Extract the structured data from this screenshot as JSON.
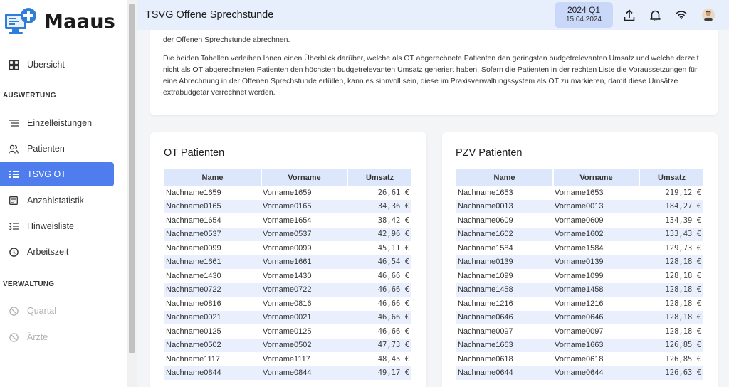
{
  "app": {
    "logo_text": "Maaus",
    "title": "TSVG Offene Sprechstunde"
  },
  "topbar": {
    "quarter": "2024 Q1",
    "date": "15.04.2024",
    "icons": [
      "upload-icon",
      "bell-icon",
      "wifi-icon",
      "avatar"
    ]
  },
  "sidebar": {
    "overview": "Übersicht",
    "section_auswertung": "AUSWERTUNG",
    "items": [
      {
        "label": "Einzelleistungen",
        "icon": "list-icon"
      },
      {
        "label": "Patienten",
        "icon": "users-icon"
      },
      {
        "label": "TSVG OT",
        "icon": "grid-list-icon",
        "active": true
      },
      {
        "label": "Anzahlstatistik",
        "icon": "document-icon"
      },
      {
        "label": "Hinweisliste",
        "icon": "checklist-icon"
      },
      {
        "label": "Arbeitszeit",
        "icon": "clock-icon"
      }
    ],
    "section_verwaltung": "VERWALTUNG",
    "admin_items": [
      {
        "label": "Quartal",
        "icon": "blocked-icon",
        "disabled": true
      },
      {
        "label": "Ärzte",
        "icon": "blocked-icon",
        "disabled": true
      }
    ]
  },
  "intro": {
    "line_top": "der Offenen Sprechstunde abrechnen.",
    "paragraph": "Die beiden Tabellen verleihen Ihnen einen Überblick darüber, welche als OT abgerechnete Patienten den geringsten budgetrelevanten Umsatz und welche derzeit nicht als OT abgerechneten Patienten den höchsten budgetrelevanten Umsatz generiert haben. Sofern die Patienten in der rechten Liste die Voraussetzungen für eine Abrechnung in der Offenen Sprechstunde erfüllen, kann es sinnvoll sein, diese im Praxisverwaltungssystem als OT zu markieren, damit diese Umsätze extrabudgetär verrechnet werden."
  },
  "ot_table": {
    "title": "OT Patienten",
    "headers": [
      "Name",
      "Vorname",
      "Umsatz"
    ],
    "rows": [
      [
        "Nachname1659",
        "Vorname1659",
        "26,61 €"
      ],
      [
        "Nachname0165",
        "Vorname0165",
        "34,36 €"
      ],
      [
        "Nachname1654",
        "Vorname1654",
        "38,42 €"
      ],
      [
        "Nachname0537",
        "Vorname0537",
        "42,96 €"
      ],
      [
        "Nachname0099",
        "Vorname0099",
        "45,11 €"
      ],
      [
        "Nachname1661",
        "Vorname1661",
        "46,54 €"
      ],
      [
        "Nachname1430",
        "Vorname1430",
        "46,66 €"
      ],
      [
        "Nachname0722",
        "Vorname0722",
        "46,66 €"
      ],
      [
        "Nachname0816",
        "Vorname0816",
        "46,66 €"
      ],
      [
        "Nachname0021",
        "Vorname0021",
        "46,66 €"
      ],
      [
        "Nachname0125",
        "Vorname0125",
        "46,66 €"
      ],
      [
        "Nachname0502",
        "Vorname0502",
        "47,73 €"
      ],
      [
        "Nachname1117",
        "Vorname1117",
        "48,45 €"
      ],
      [
        "Nachname0844",
        "Vorname0844",
        "49,17 €"
      ]
    ]
  },
  "pzv_table": {
    "title": "PZV Patienten",
    "headers": [
      "Name",
      "Vorname",
      "Umsatz"
    ],
    "rows": [
      [
        "Nachname1653",
        "Vorname1653",
        "219,12 €"
      ],
      [
        "Nachname0013",
        "Vorname0013",
        "184,27 €"
      ],
      [
        "Nachname0609",
        "Vorname0609",
        "134,39 €"
      ],
      [
        "Nachname1602",
        "Vorname1602",
        "133,43 €"
      ],
      [
        "Nachname1584",
        "Vorname1584",
        "129,73 €"
      ],
      [
        "Nachname0139",
        "Vorname0139",
        "128,18 €"
      ],
      [
        "Nachname1099",
        "Vorname1099",
        "128,18 €"
      ],
      [
        "Nachname1458",
        "Vorname1458",
        "128,18 €"
      ],
      [
        "Nachname1216",
        "Vorname1216",
        "128,18 €"
      ],
      [
        "Nachname0646",
        "Vorname0646",
        "128,18 €"
      ],
      [
        "Nachname0097",
        "Vorname0097",
        "128,18 €"
      ],
      [
        "Nachname1663",
        "Vorname1663",
        "126,85 €"
      ],
      [
        "Nachname0618",
        "Vorname0618",
        "126,85 €"
      ],
      [
        "Nachname0644",
        "Vorname0644",
        "126,63 €"
      ]
    ]
  },
  "colors": {
    "accent": "#4f7dee",
    "topbar_bg": "#e7eefc",
    "quarter_bg": "#c9d8f9",
    "table_header_bg": "#dde7fb",
    "table_alt_row_bg": "#e9effc",
    "logo_blue": "#2f7fd8"
  }
}
